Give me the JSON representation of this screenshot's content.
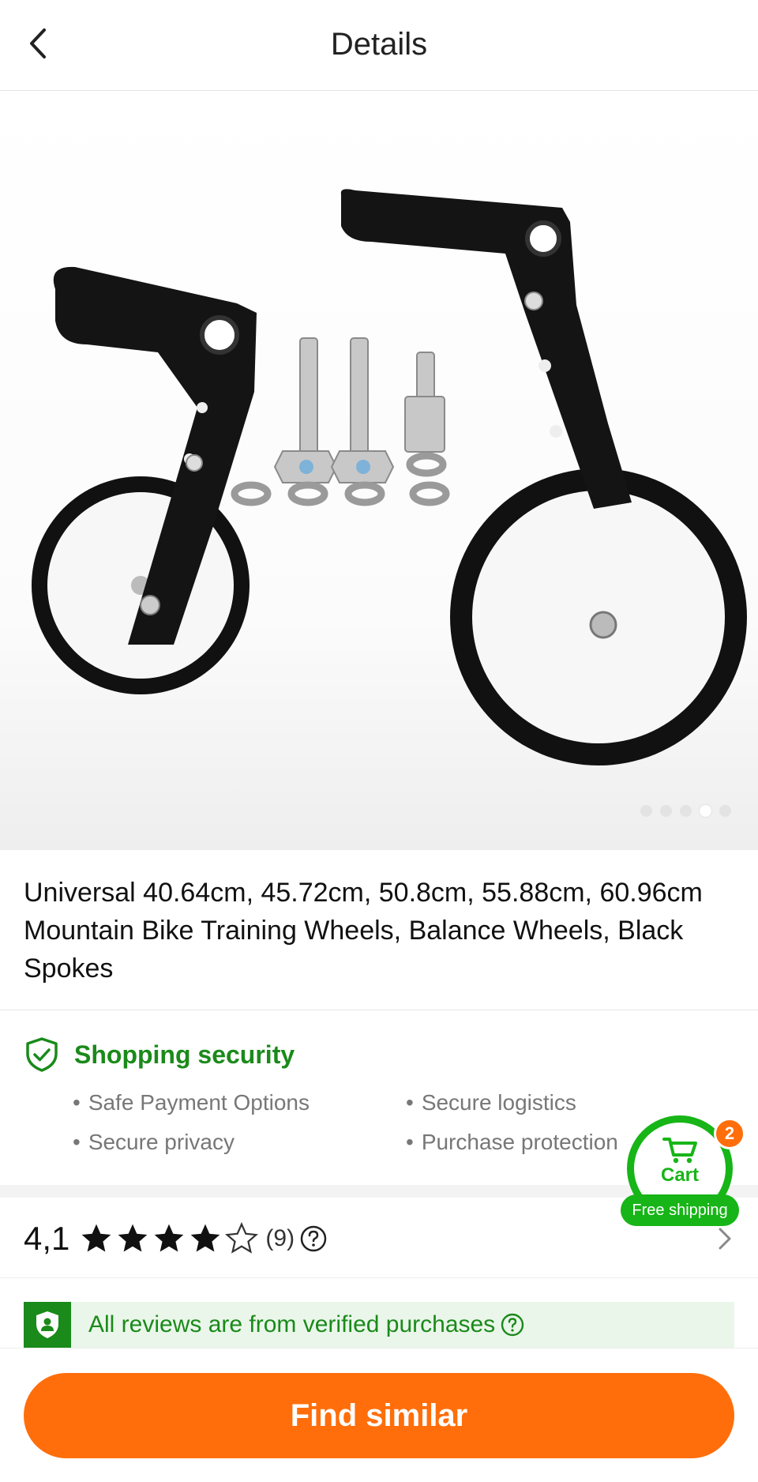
{
  "header": {
    "title": "Details"
  },
  "product": {
    "title": "Universal 40.64cm, 45.72cm, 50.8cm, 55.88cm, 60.96cm Mountain Bike Training Wheels, Balance Wheels, Black Spokes",
    "image_count": 5,
    "active_image_index": 3
  },
  "security": {
    "title": "Shopping security",
    "items": [
      "Safe Payment Options",
      "Secure logistics",
      "Secure privacy",
      "Purchase protection"
    ]
  },
  "rating": {
    "score": "4,1",
    "stars": 4.1,
    "max_stars": 5,
    "count": "(9)"
  },
  "verified": {
    "text": "All reviews are from verified purchases"
  },
  "cart": {
    "label": "Cart",
    "badge": "2",
    "free_shipping": "Free shipping"
  },
  "actions": {
    "find_similar": "Find similar"
  },
  "colors": {
    "accent_orange": "#ff6e0b",
    "brand_green": "#1a8a1a",
    "cart_green": "#17b517"
  }
}
